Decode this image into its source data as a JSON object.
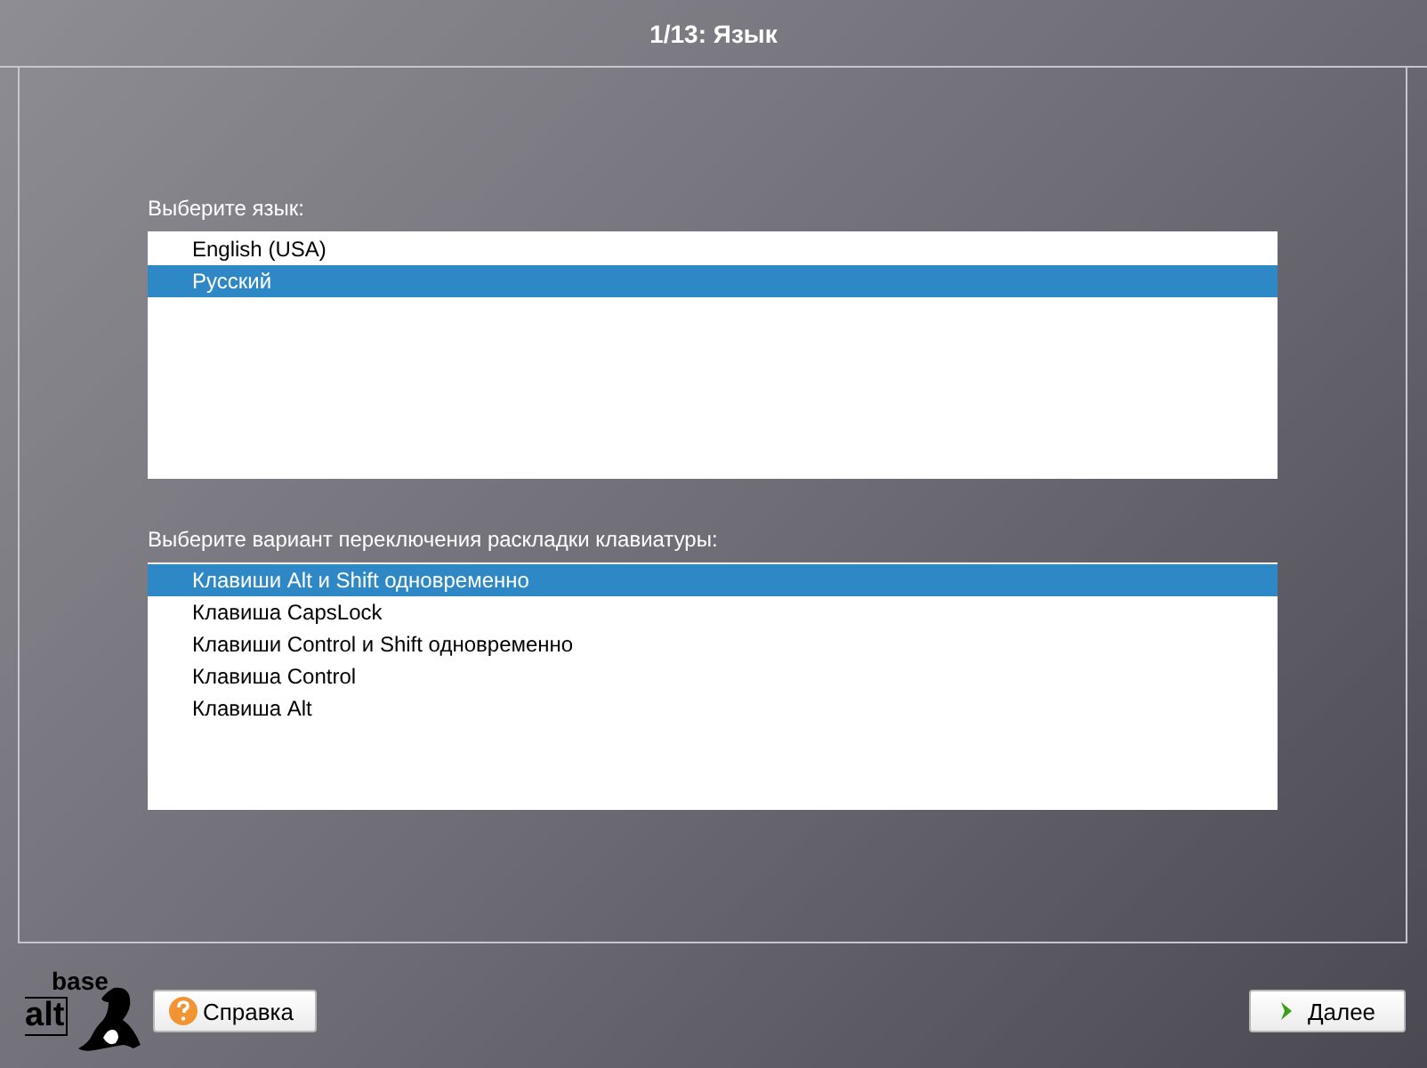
{
  "window": {
    "title": "1/13: Язык"
  },
  "language": {
    "label": "Выберите язык:",
    "items": [
      {
        "text": "English (USA)",
        "selected": false
      },
      {
        "text": "Русский",
        "selected": true
      }
    ]
  },
  "layout_switch": {
    "label": "Выберите вариант переключения раскладки клавиатуры:",
    "items": [
      {
        "text": "Клавиши Alt и Shift одновременно",
        "selected": true
      },
      {
        "text": "Клавиша CapsLock",
        "selected": false
      },
      {
        "text": "Клавиши Control и Shift одновременно",
        "selected": false
      },
      {
        "text": "Клавиша Control",
        "selected": false
      },
      {
        "text": "Клавиша Alt",
        "selected": false
      }
    ]
  },
  "logo": {
    "top": "base",
    "bottom": "alt"
  },
  "buttons": {
    "help": "Справка",
    "next": "Далее"
  }
}
